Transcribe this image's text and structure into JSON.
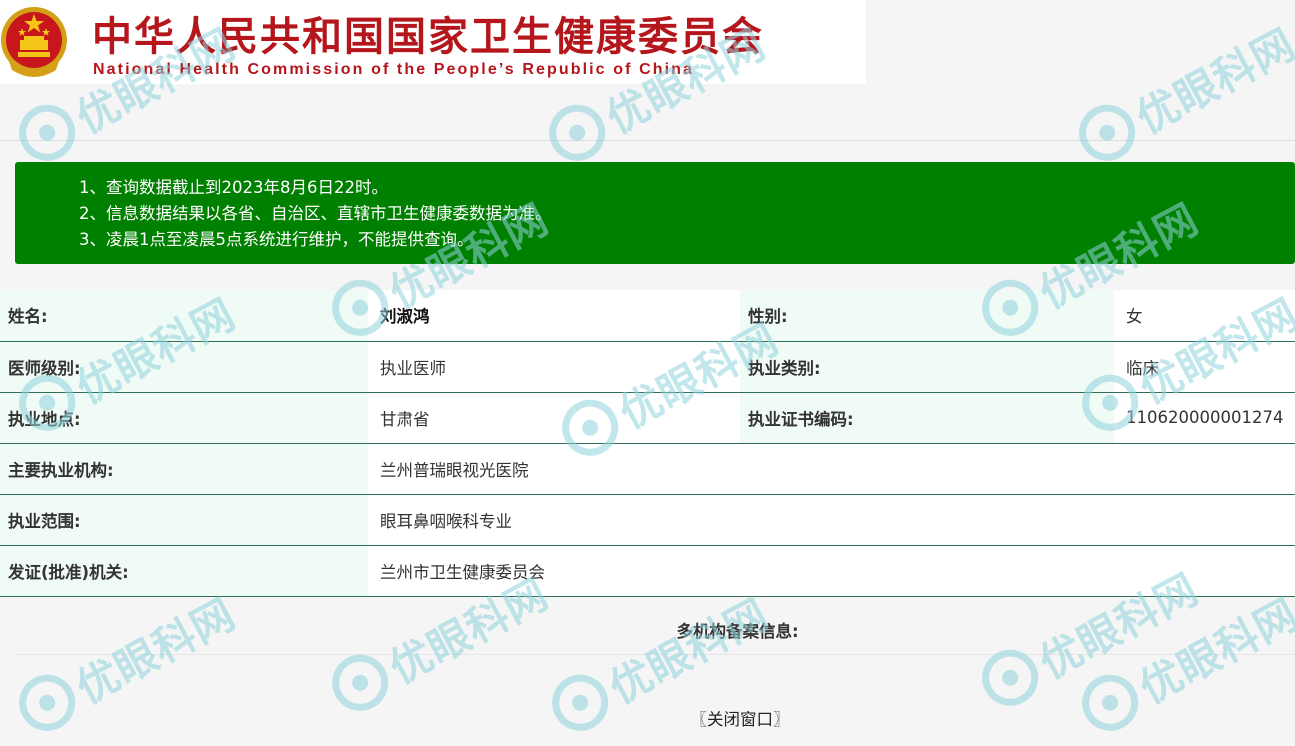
{
  "header": {
    "title": "中华人民共和国国家卫生健康委员会",
    "subtitle": "National Health Commission of the People’s Republic of China"
  },
  "notice": [
    "1、查询数据截止到2023年8月6日22时。",
    "2、信息数据结果以各省、自治区、直辖市卫生健康委数据为准。",
    "3、凌晨1点至凌晨5点系统进行维护，不能提供查询。"
  ],
  "record": {
    "name_label": "姓名:",
    "name_value": "刘淑鸿",
    "gender_label": "性别:",
    "gender_value": "女",
    "level_label": "医师级别:",
    "level_value": "执业医师",
    "category_label": "执业类别:",
    "category_value": "临床",
    "location_label": "执业地点:",
    "location_value": "甘肃省",
    "cert_label": "执业证书编码:",
    "cert_value": "110620000001274",
    "institution_label": "主要执业机构:",
    "institution_value": "兰州普瑞眼视光医院",
    "scope_label": "执业范围:",
    "scope_value": "眼耳鼻咽喉科专业",
    "authority_label": "发证(批准)机关:",
    "authority_value": "兰州市卫生健康委员会"
  },
  "multi_institution_label": "多机构备案信息:",
  "close_link": "〖关闭窗口〗",
  "watermark": {
    "text": "优眼科网",
    "color": "#8fd3dc"
  },
  "colors": {
    "brand_red": "#b4161b",
    "notice_green": "#008000",
    "label_bg": "#f0fbf5",
    "row_border": "#2f6f5a"
  }
}
